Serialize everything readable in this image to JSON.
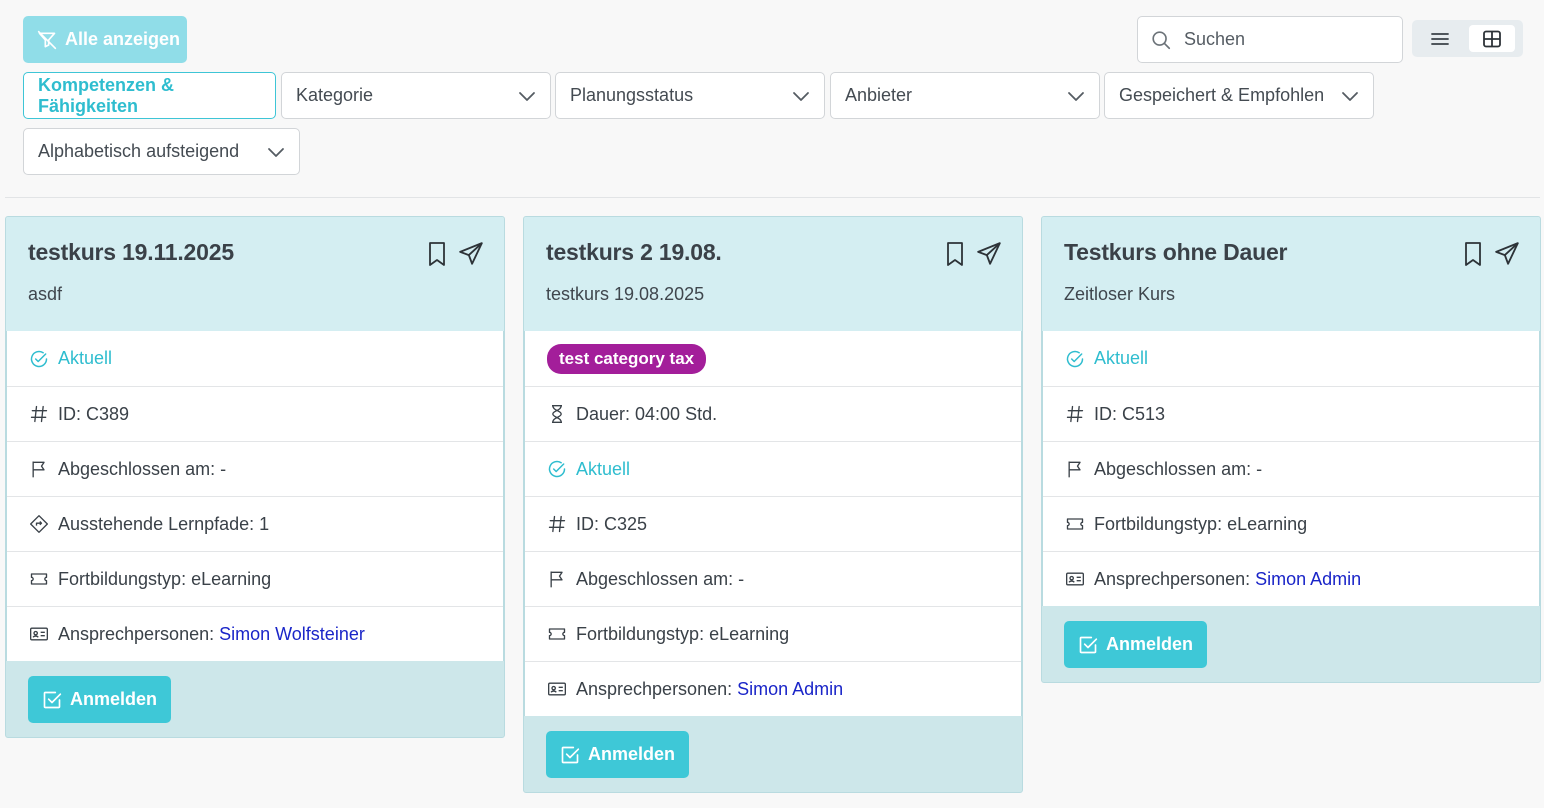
{
  "toolbar": {
    "clear_label": "Alle anzeigen",
    "search_placeholder": "Suchen",
    "filters": {
      "skills": "Kompetenzen & Fähigkeiten",
      "category": "Kategorie",
      "planning": "Planungsstatus",
      "provider": "Anbieter",
      "saved": "Gespeichert & Empfohlen",
      "sort": "Alphabetisch aufsteigend"
    }
  },
  "colors": {
    "accent": "#3ec8d7",
    "badge": "#a31e9a",
    "link": "#1a25c8"
  },
  "cards": [
    {
      "title": "testkurs 19.11.2025",
      "subtitle": "asdf",
      "status": "Aktuell",
      "id": "ID: C389",
      "completed": "Abgeschlossen am: -",
      "pending": "Ausstehende Lernpfade: 1",
      "type": "Fortbildungstyp: eLearning",
      "contact_label": "Ansprechpersonen: ",
      "contact_name": "Simon Wolfsteiner",
      "enroll": "Anmelden"
    },
    {
      "title": "testkurs 2 19.08.",
      "subtitle": "testkurs 19.08.2025",
      "category": "test category tax",
      "duration": "Dauer: 04:00 Std.",
      "status": "Aktuell",
      "id": "ID: C325",
      "completed": "Abgeschlossen am: -",
      "type": "Fortbildungstyp: eLearning",
      "contact_label": "Ansprechpersonen: ",
      "contact_name": "Simon Admin",
      "enroll": "Anmelden"
    },
    {
      "title": "Testkurs ohne Dauer",
      "subtitle": "Zeitloser Kurs",
      "status": "Aktuell",
      "id": "ID: C513",
      "completed": "Abgeschlossen am: -",
      "type": "Fortbildungstyp: eLearning",
      "contact_label": "Ansprechpersonen: ",
      "contact_name": "Simon Admin",
      "enroll": "Anmelden"
    }
  ]
}
